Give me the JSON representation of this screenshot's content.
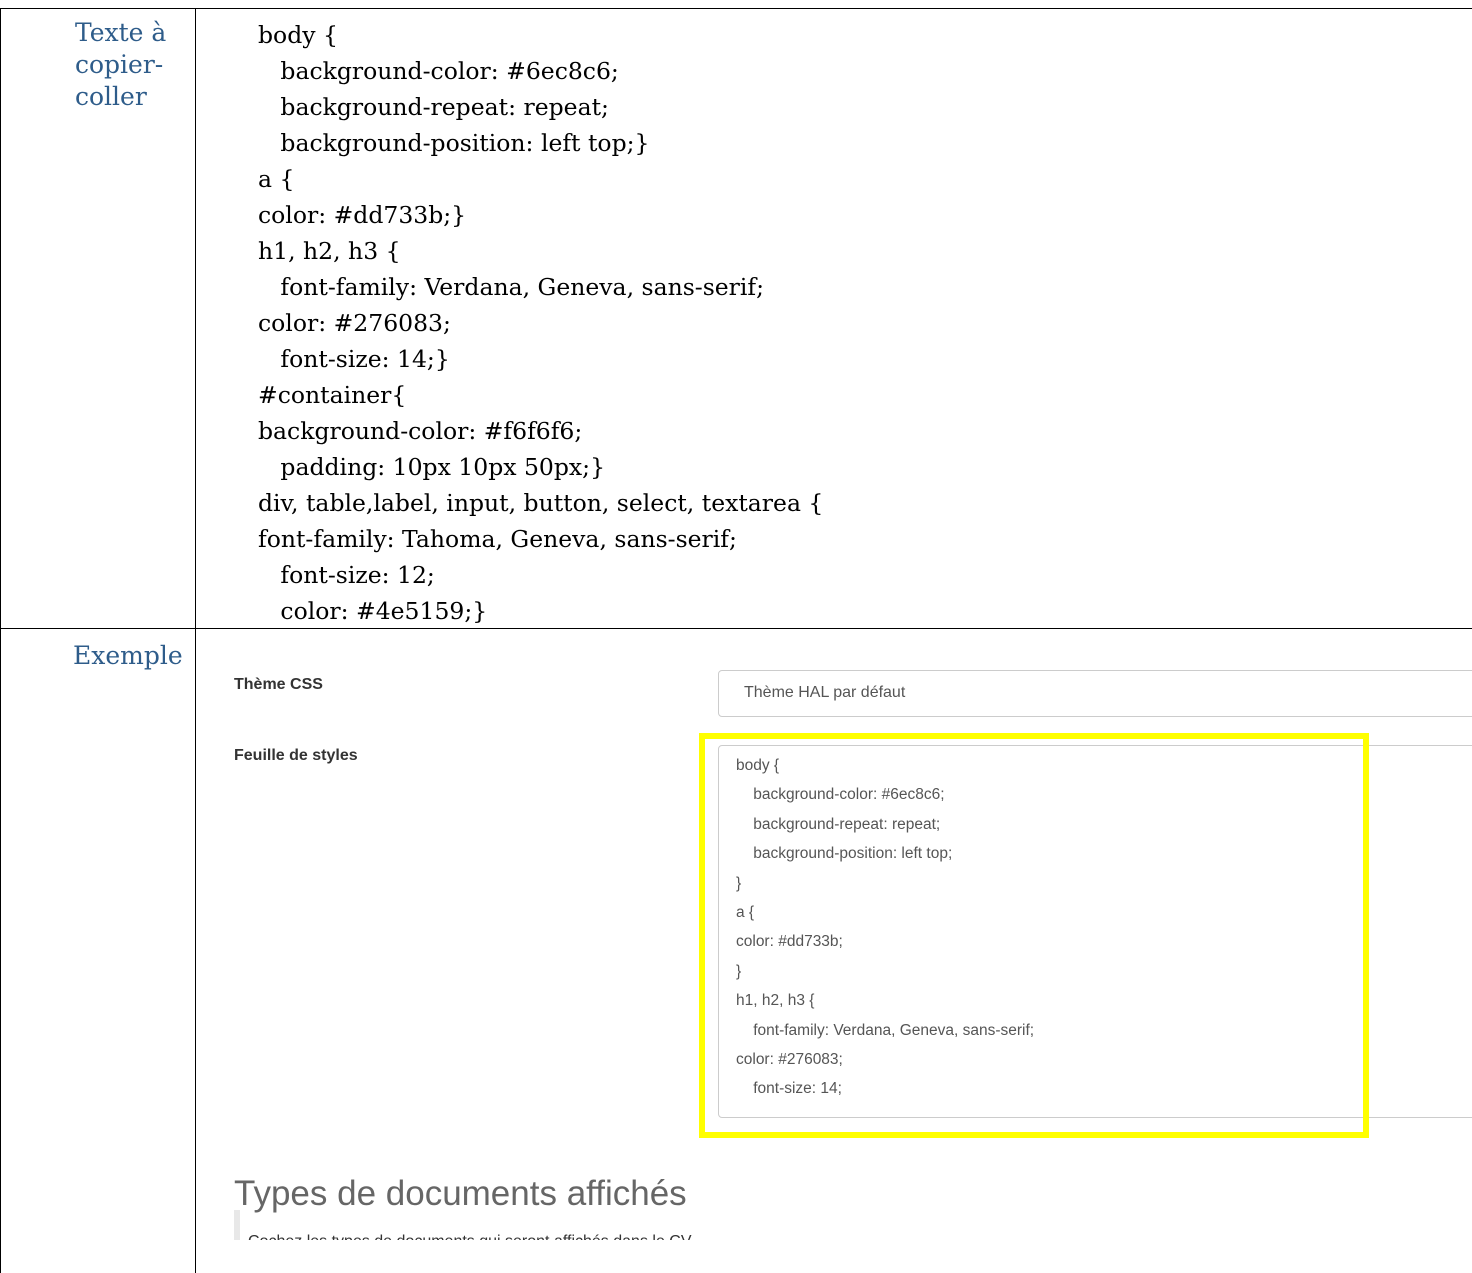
{
  "labels": {
    "top": "Texte à\ncopier-\ncoller",
    "bottom": "Exemple"
  },
  "code_lines": [
    "body {",
    "   background-color: #6ec8c6;",
    "   background-repeat: repeat;",
    "   background-position: left top;}",
    "a {",
    "color: #dd733b;}",
    "h1, h2, h3 {",
    "   font-family: Verdana, Geneva, sans-serif;",
    "color: #276083;",
    "   font-size: 14;}",
    "#container{",
    "background-color: #f6f6f6;",
    "   padding: 10px 10px 50px;}",
    "div, table,label, input, button, select, textarea {",
    "font-family: Tahoma, Geneva, sans-serif;",
    "   font-size: 12;",
    "   color: #4e5159;}"
  ],
  "example": {
    "theme_label": "Thème CSS",
    "theme_value": "Thème HAL par défaut",
    "stylesheet_label": "Feuille de styles",
    "textarea_lines": [
      "body {",
      "    background-color: #6ec8c6;",
      "    background-repeat: repeat;",
      "    background-position: left top;",
      "}",
      "a {",
      "color: #dd733b;",
      "}",
      "h1, h2, h3 {",
      "    font-family: Verdana, Geneva, sans-serif;",
      "color: #276083;",
      "    font-size: 14;",
      ""
    ],
    "section_title": "Types de documents affichés",
    "help_text": "Cochez les types de documents qui seront affichés dans le CV"
  },
  "colors": {
    "label": "#2e5c8a",
    "highlight": "#ffff00"
  }
}
